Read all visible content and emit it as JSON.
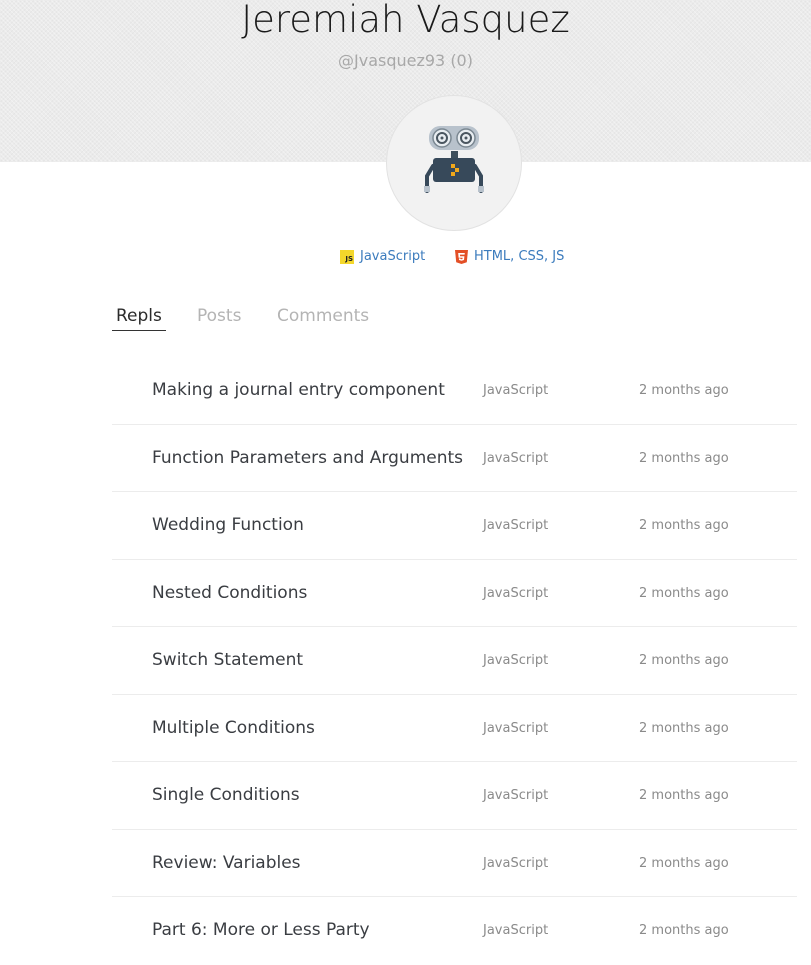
{
  "profile": {
    "name": "Jeremiah Vasquez",
    "handle": "@Jvasquez93 (0)"
  },
  "languages": [
    {
      "label": "JavaScript",
      "icon": "javascript-icon"
    },
    {
      "label": "HTML, CSS, JS",
      "icon": "html5-icon"
    }
  ],
  "tabs": [
    {
      "label": "Repls",
      "active": true
    },
    {
      "label": "Posts",
      "active": false
    },
    {
      "label": "Comments",
      "active": false
    }
  ],
  "repls": [
    {
      "title": "Making a journal entry component",
      "language": "JavaScript",
      "time": "2 months ago"
    },
    {
      "title": "Function Parameters and Arguments",
      "language": "JavaScript",
      "time": "2 months ago"
    },
    {
      "title": "Wedding Function",
      "language": "JavaScript",
      "time": "2 months ago"
    },
    {
      "title": "Nested Conditions",
      "language": "JavaScript",
      "time": "2 months ago"
    },
    {
      "title": "Switch Statement",
      "language": "JavaScript",
      "time": "2 months ago"
    },
    {
      "title": "Multiple Conditions",
      "language": "JavaScript",
      "time": "2 months ago"
    },
    {
      "title": "Single Conditions",
      "language": "JavaScript",
      "time": "2 months ago"
    },
    {
      "title": "Review: Variables",
      "language": "JavaScript",
      "time": "2 months ago"
    },
    {
      "title": "Part 6: More or Less Party",
      "language": "JavaScript",
      "time": "2 months ago"
    }
  ],
  "colors": {
    "link": "#3b7bbd",
    "js_badge": "#f4d72b",
    "html5": "#e34f26"
  }
}
